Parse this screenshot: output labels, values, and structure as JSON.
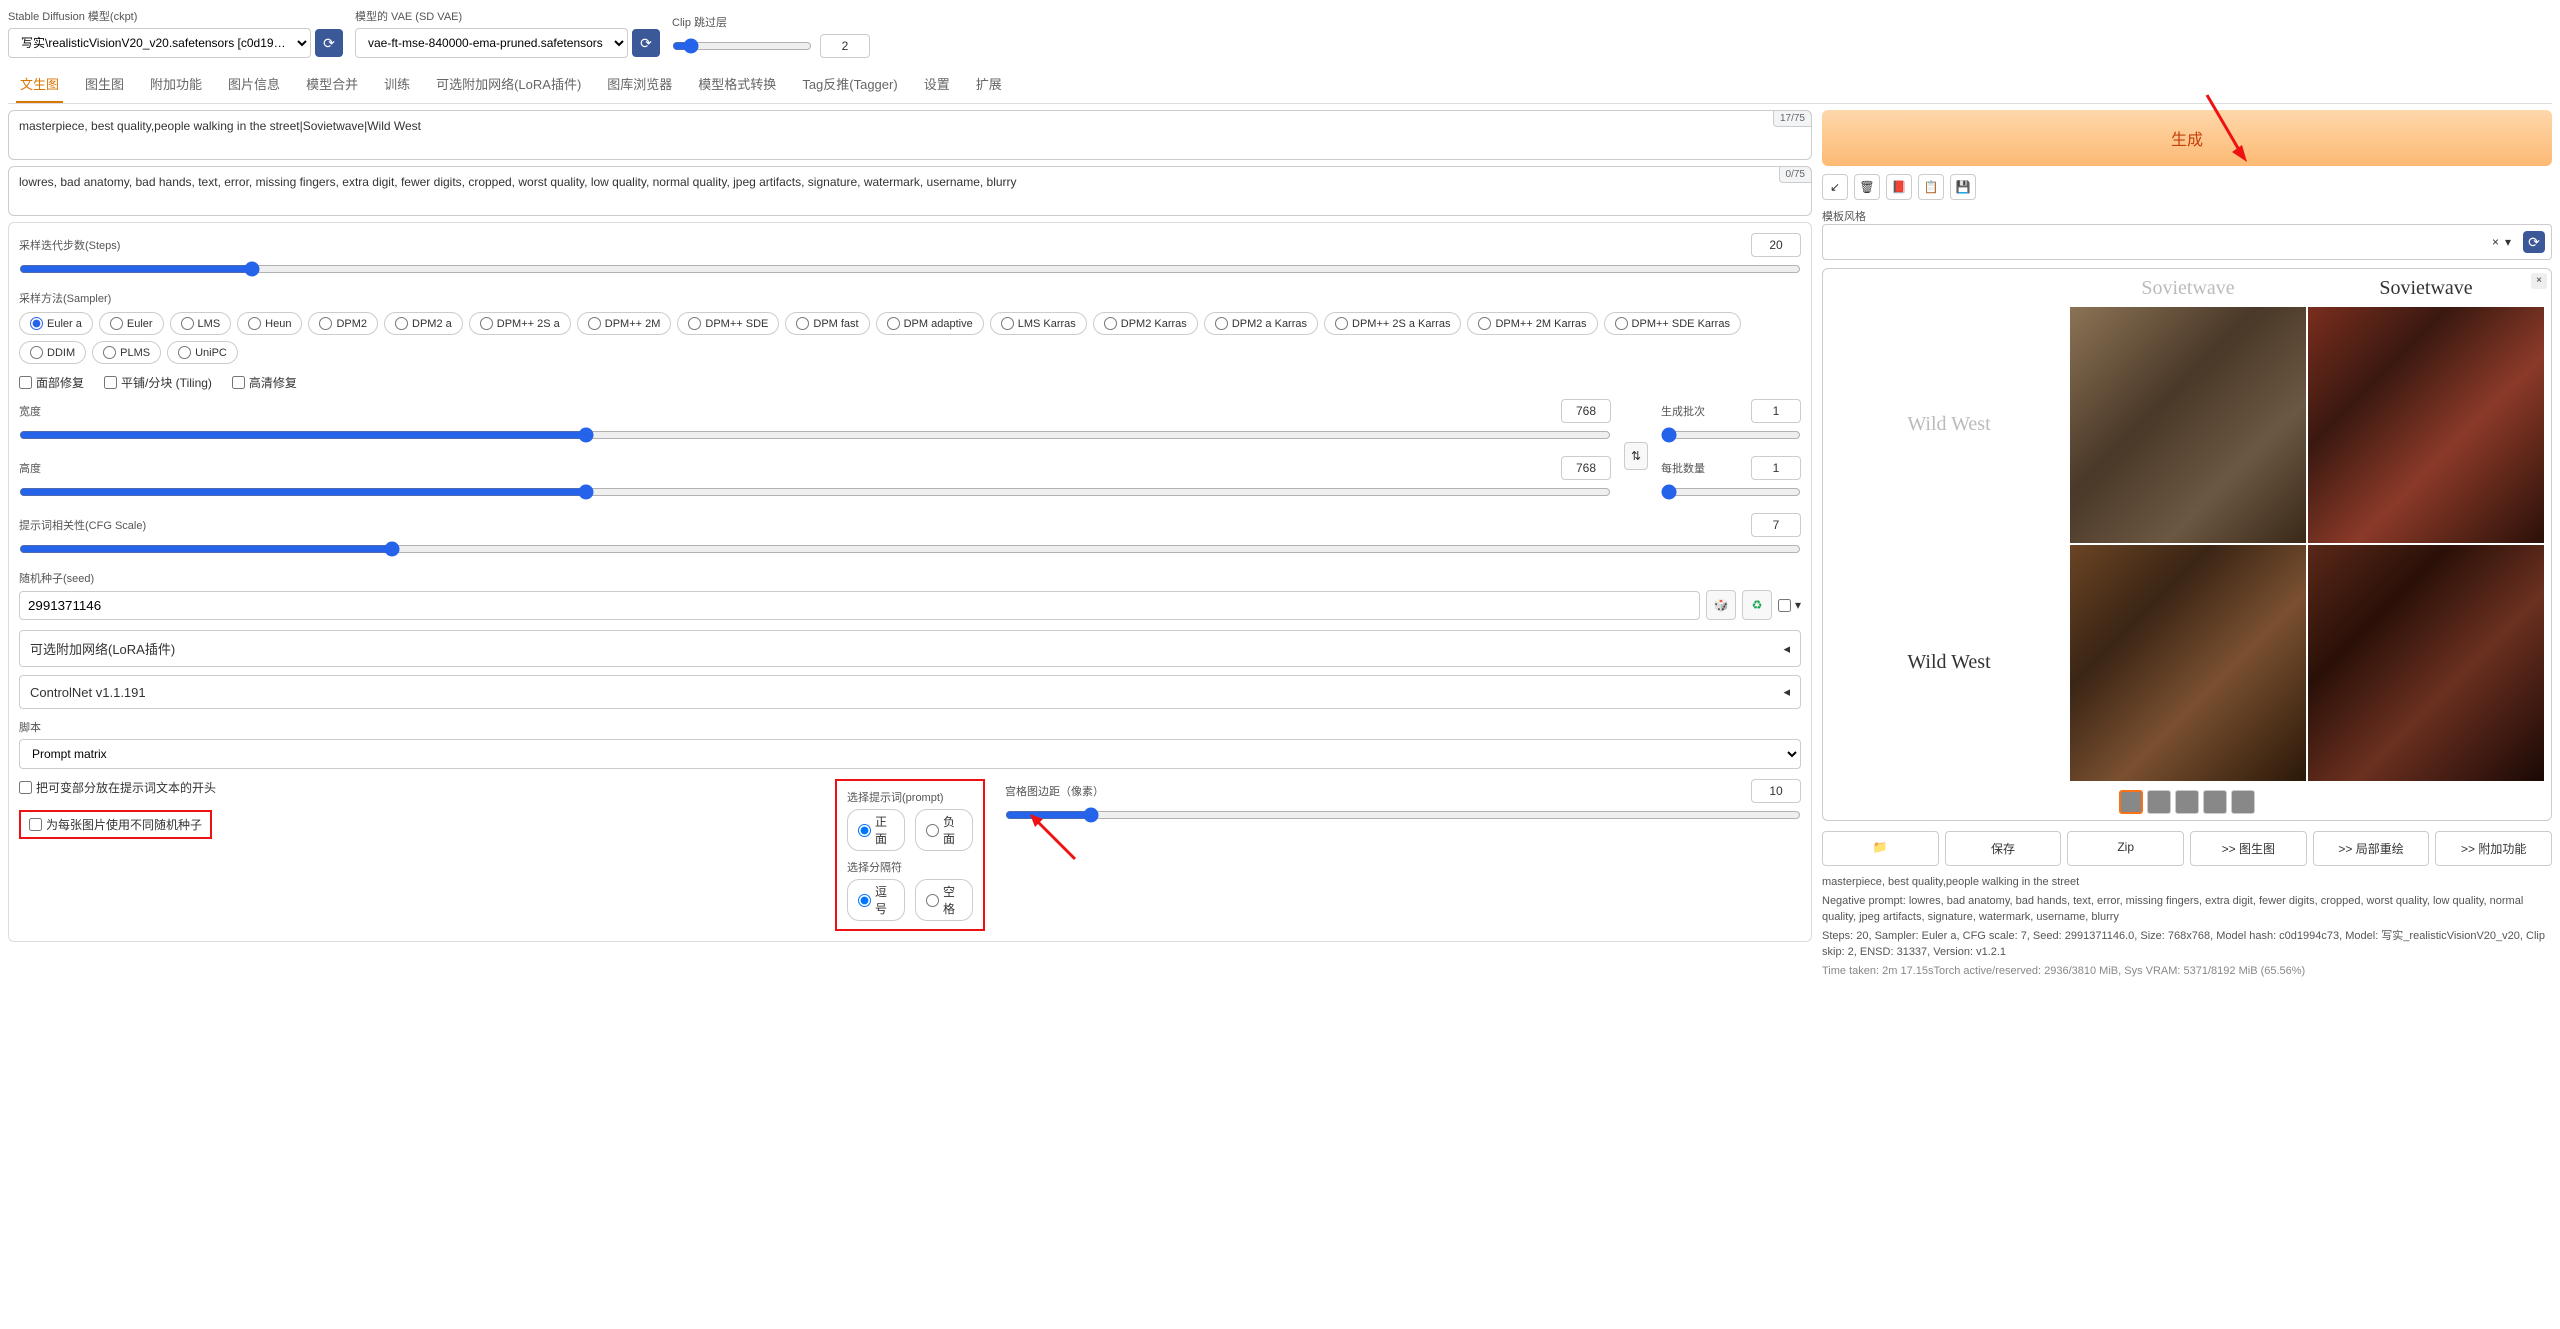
{
  "top": {
    "model_label": "Stable Diffusion 模型(ckpt)",
    "model_value": "写实\\realisticVisionV20_v20.safetensors [c0d19…",
    "vae_label": "模型的 VAE (SD VAE)",
    "vae_value": "vae-ft-mse-840000-ema-pruned.safetensors",
    "clip_label": "Clip 跳过层",
    "clip_value": "2"
  },
  "tabs": [
    "文生图",
    "图生图",
    "附加功能",
    "图片信息",
    "模型合并",
    "训练",
    "可选附加网络(LoRA插件)",
    "图库浏览器",
    "模型格式转换",
    "Tag反推(Tagger)",
    "设置",
    "扩展"
  ],
  "prompt": {
    "positive": "masterpiece, best quality,people walking in the street|Sovietwave|Wild West",
    "positive_count": "17/75",
    "negative": "lowres, bad anatomy, bad hands, text, error, missing fingers, extra digit, fewer digits, cropped, worst quality, low quality, normal quality, jpeg artifacts, signature, watermark, username, blurry",
    "negative_count": "0/75"
  },
  "params": {
    "steps_label": "采样迭代步数(Steps)",
    "steps_value": "20",
    "sampler_label": "采样方法(Sampler)",
    "samplers": [
      "Euler a",
      "Euler",
      "LMS",
      "Heun",
      "DPM2",
      "DPM2 a",
      "DPM++ 2S a",
      "DPM++ 2M",
      "DPM++ SDE",
      "DPM fast",
      "DPM adaptive",
      "LMS Karras",
      "DPM2 Karras",
      "DPM2 a Karras",
      "DPM++ 2S a Karras",
      "DPM++ 2M Karras",
      "DPM++ SDE Karras",
      "DDIM",
      "PLMS",
      "UniPC"
    ],
    "sampler_selected": "Euler a",
    "restore_faces": "面部修复",
    "tiling": "平铺/分块 (Tiling)",
    "hires": "高清修复",
    "width_label": "宽度",
    "width_value": "768",
    "height_label": "高度",
    "height_value": "768",
    "batch_count_label": "生成批次",
    "batch_count_value": "1",
    "batch_size_label": "每批数量",
    "batch_size_value": "1",
    "cfg_label": "提示词相关性(CFG Scale)",
    "cfg_value": "7",
    "seed_label": "随机种子(seed)",
    "seed_value": "2991371146",
    "lora_label": "可选附加网络(LoRA插件)",
    "controlnet_label": "ControlNet v1.1.191",
    "script_label": "脚本",
    "script_value": "Prompt matrix"
  },
  "matrix": {
    "put_at_start": "把可变部分放在提示词文本的开头",
    "different_seed": "为每张图片使用不同随机种子",
    "select_prompt_label": "选择提示词(prompt)",
    "prompt_pos": "正面",
    "prompt_neg": "负面",
    "delimiter_label": "选择分隔符",
    "delim_comma": "逗号",
    "delim_space": "空格",
    "margin_label": "宫格图边距（像素）",
    "margin_value": "10"
  },
  "right": {
    "generate": "生成",
    "style_label": "模板风格",
    "col_labels": [
      "Sovietwave",
      "Sovietwave"
    ],
    "row_labels": [
      "Wild West",
      "Wild West"
    ],
    "actions": {
      "folder": "📁",
      "save": "保存",
      "zip": "Zip",
      "to_img2img": ">> 图生图",
      "to_inpaint": ">> 局部重绘",
      "to_extras": ">> 附加功能"
    },
    "meta1": "masterpiece, best quality,people walking in the street",
    "meta2": "Negative prompt: lowres, bad anatomy, bad hands, text, error, missing fingers, extra digit, fewer digits, cropped, worst quality, low quality, normal quality, jpeg artifacts, signature, watermark, username, blurry",
    "meta3": "Steps: 20, Sampler: Euler a, CFG scale: 7, Seed: 2991371146.0, Size: 768x768, Model hash: c0d1994c73, Model: 写实_realisticVisionV20_v20, Clip skip: 2, ENSD: 31337, Version: v1.2.1",
    "meta4": "Time taken: 2m 17.15sTorch active/reserved: 2936/3810 MiB, Sys VRAM: 5371/8192 MiB (65.56%)"
  },
  "chart_data": {
    "type": "table",
    "title": "Prompt matrix grid",
    "columns": [
      "",
      "Sovietwave"
    ],
    "rows": [
      "",
      "Wild West"
    ],
    "cells_desc": "2x2 generated images of people walking in street; top row urban Soviet-style, bottom row western cowboys"
  }
}
